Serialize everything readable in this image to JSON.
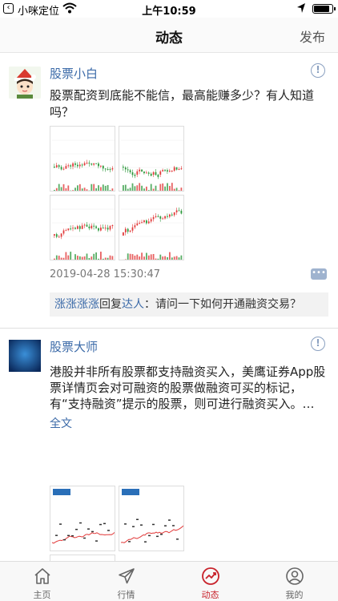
{
  "status_bar": {
    "carrier": "小咪定位",
    "time": "上午10:59",
    "battery_level": 0.92
  },
  "nav": {
    "title": "动态",
    "publish_label": "发布"
  },
  "posts": [
    {
      "username": "股票小白",
      "report_symbol": "!",
      "content": "股票配资到底能不能信，最高能赚多少？有人知道吗？",
      "timestamp": "2019-04-28 15:30:47",
      "reply": {
        "from": "涨涨涨涨",
        "verb": "回复",
        "to": "达人",
        "text": "：请问一下如何开通融资交易？"
      }
    },
    {
      "username": "股票大师",
      "report_symbol": "!",
      "content": "港股并非所有股票都支持融资买入，美鹰证券App股票详情页会对可融资的股票做融资可买的标记，有“支持融资”提示的股票，则可进行融资买入。…",
      "full_text_label": "全文"
    }
  ],
  "tabs": [
    {
      "label": "主页",
      "icon": "home-icon",
      "active": false
    },
    {
      "label": "行情",
      "icon": "paper-plane-icon",
      "active": false
    },
    {
      "label": "动态",
      "icon": "trend-icon",
      "active": true
    },
    {
      "label": "我的",
      "icon": "profile-icon",
      "active": false
    }
  ],
  "colors": {
    "accent": "#c8222b",
    "link": "#3b6aa8",
    "candle_up": "#e23b3b",
    "candle_down": "#2e9a3e"
  }
}
